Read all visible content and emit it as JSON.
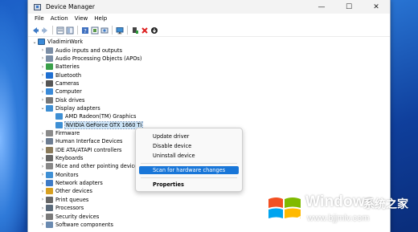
{
  "window": {
    "title": "Device Manager",
    "controls": {
      "minimize": "—",
      "maximize": "☐",
      "close": "✕"
    }
  },
  "menu": [
    "File",
    "Action",
    "View",
    "Help"
  ],
  "toolbar": {
    "icons": [
      "back-arrow-icon",
      "forward-arrow-icon",
      "properties-view-icon",
      "show-hide-icon",
      "help-icon",
      "device-view-icon",
      "refresh-icon",
      "computer-monitor-icon",
      "add-driver-icon",
      "remove-device-icon",
      "update-driver-icon"
    ]
  },
  "tree": {
    "root": "VladimirWork",
    "items": [
      {
        "label": "Audio inputs and outputs",
        "expanded": false,
        "icon": "audio-icon"
      },
      {
        "label": "Audio Processing Objects (APOs)",
        "expanded": false,
        "icon": "audio-icon"
      },
      {
        "label": "Batteries",
        "expanded": false,
        "icon": "battery-icon"
      },
      {
        "label": "Bluetooth",
        "expanded": false,
        "icon": "bluetooth-icon"
      },
      {
        "label": "Cameras",
        "expanded": false,
        "icon": "camera-icon"
      },
      {
        "label": "Computer",
        "expanded": false,
        "icon": "computer-icon"
      },
      {
        "label": "Disk drives",
        "expanded": false,
        "icon": "disk-icon"
      },
      {
        "label": "Display adapters",
        "expanded": true,
        "icon": "display-icon"
      },
      {
        "label": "AMD Radeon(TM) Graphics",
        "child": true,
        "icon": "display-icon"
      },
      {
        "label": "NVIDIA GeForce GTX 1660 Ti",
        "child": true,
        "selected": true,
        "icon": "display-icon"
      },
      {
        "label": "Firmware",
        "expanded": false,
        "icon": "firmware-icon"
      },
      {
        "label": "Human Interface Devices",
        "expanded": false,
        "icon": "hid-icon"
      },
      {
        "label": "IDE ATA/ATAPI controllers",
        "expanded": false,
        "icon": "ide-icon"
      },
      {
        "label": "Keyboards",
        "expanded": false,
        "icon": "keyboard-icon"
      },
      {
        "label": "Mice and other pointing devices",
        "expanded": false,
        "icon": "mouse-icon"
      },
      {
        "label": "Monitors",
        "expanded": false,
        "icon": "monitor-icon"
      },
      {
        "label": "Network adapters",
        "expanded": false,
        "icon": "network-icon"
      },
      {
        "label": "Other devices",
        "expanded": false,
        "icon": "other-devices-icon"
      },
      {
        "label": "Print queues",
        "expanded": false,
        "icon": "printer-icon"
      },
      {
        "label": "Processors",
        "expanded": false,
        "icon": "processor-icon"
      },
      {
        "label": "Security devices",
        "expanded": false,
        "icon": "security-icon"
      },
      {
        "label": "Software components",
        "expanded": false,
        "icon": "software-icon"
      }
    ]
  },
  "context_menu": {
    "items": [
      {
        "label": "Update driver"
      },
      {
        "label": "Disable device"
      },
      {
        "label": "Uninstall device"
      },
      {
        "label": "Scan for hardware changes",
        "highlighted": true
      },
      {
        "label": "Properties",
        "bold": true
      }
    ]
  },
  "watermark": {
    "title": "Windows",
    "cn": "系统之家",
    "url": "www.bjjmlv.com"
  },
  "colors": {
    "accent": "#1976d8",
    "selection": "#cce4f7",
    "desktop": "#1b5fc7"
  }
}
